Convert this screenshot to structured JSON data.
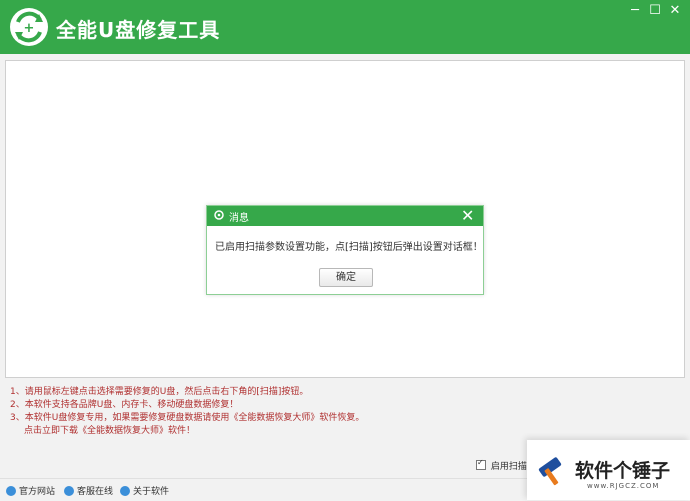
{
  "app": {
    "title": "全能U盘修复工具",
    "accent_color": "#36a84a",
    "window_controls": {
      "minimize": "─",
      "maximize": "☐",
      "close": "✕"
    }
  },
  "dialog": {
    "title": "消息",
    "message": "已启用扫描参数设置功能，点[扫描]按钮后弹出设置对话框！",
    "ok_label": "确定",
    "close_glyph": "✕"
  },
  "tips": [
    "1、请用鼠标左键点击选择需要修复的U盘，然后点击右下角的[扫描]按钮。",
    "2、本软件支持各品牌U盘、内存卡、移动硬盘数据修复！",
    "3、本软件U盘修复专用，如果需要修复硬盘数据请使用《全能数据恢复大师》软件恢复。",
    "点击立即下载《全能数据恢复大师》软件！"
  ],
  "options": {
    "enable_scan_label": "启用扫描参",
    "enable_scan_checked": true
  },
  "footer": {
    "links": [
      {
        "label": "官方网站",
        "icon": "home-icon"
      },
      {
        "label": "客服在线",
        "icon": "chat-icon"
      },
      {
        "label": "关于软件",
        "icon": "info-icon"
      }
    ]
  },
  "watermark": {
    "text": "软件个锤子",
    "sub": "www.RJGCZ.COM"
  }
}
